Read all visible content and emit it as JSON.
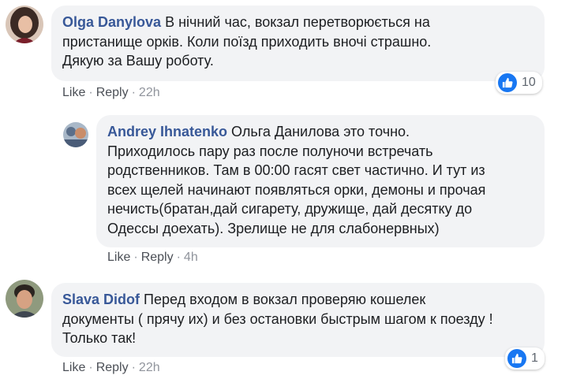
{
  "comments": [
    {
      "author": "Olga Danylova",
      "text_lines": [
        "В нічний час, вокзал перетворюється на",
        "пристанище орків. Коли поїзд приходить вночі страшно.",
        "Дякую за Вашу роботу."
      ],
      "like_label": "Like",
      "reply_label": "Reply",
      "time": "22h",
      "reaction_count": "10",
      "reaction_icon": "thumbs-up-icon"
    },
    {
      "author": "Andrey Ihnatenko",
      "text_lines": [
        "Ольга Данилова это точно.",
        "Приходилось пару раз после полуночи встречать",
        "родственников. Там в 00:00 гасят свет частично. И тут из",
        "всех щелей начинают появляться орки, демоны и прочая",
        "нечисть(братан,дай сигарету, дружище, дай десятку до",
        "Одессы доехать). Зрелище не для слабонервных)"
      ],
      "like_label": "Like",
      "reply_label": "Reply",
      "time": "4h"
    },
    {
      "author": "Slava Didof",
      "text_lines": [
        "Перед входом в вокзал проверяю кошелек",
        "документы ( прячу их) и без остановки быстрым шагом к поезду !",
        "Только так!"
      ],
      "like_label": "Like",
      "reply_label": "Reply",
      "time": "22h",
      "reaction_count": "1",
      "reaction_icon": "thumbs-up-icon"
    }
  ],
  "colors": {
    "author": "#385898",
    "bubble": "#f2f3f5",
    "like_blue": "#1877f2",
    "meta": "#90949c"
  }
}
